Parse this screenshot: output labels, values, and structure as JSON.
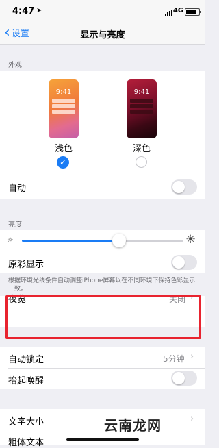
{
  "status": {
    "time": "4:47",
    "network": "4G"
  },
  "nav": {
    "back_label": "设置",
    "title": "显示与亮度"
  },
  "appearance": {
    "header": "外观",
    "light_label": "浅色",
    "dark_label": "深色",
    "preview_time": "9:41",
    "auto_label": "自动"
  },
  "brightness": {
    "header": "亮度",
    "level": 0.6,
    "true_tone_label": "原彩显示",
    "note": "根据环境光线条件自动调整iPhone屏幕以在不同环境下保持色彩显示一致。"
  },
  "night_shift": {
    "label": "夜览",
    "value": "关闭"
  },
  "lock": {
    "auto_lock_label": "自动锁定",
    "auto_lock_value": "5分钟",
    "raise_label": "抬起唤醒"
  },
  "text": {
    "size_label": "文字大小",
    "bold_label": "粗体文本"
  },
  "watermark": "云南龙网",
  "colors": {
    "accent": "#1a7cf5",
    "highlight": "#e8232f"
  }
}
